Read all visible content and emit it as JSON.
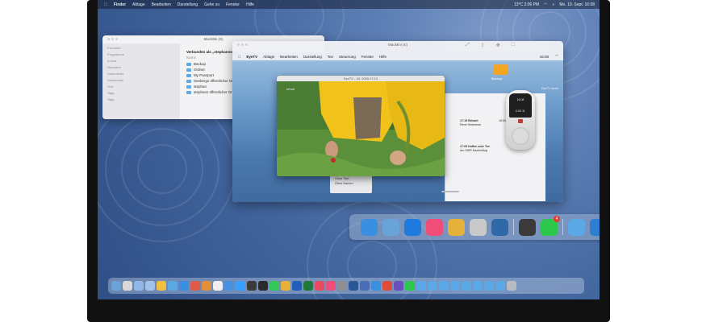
{
  "host_menubar": {
    "items": [
      "Finder",
      "Ablage",
      "Bearbeiten",
      "Darstellung",
      "Gehe zu",
      "Fenster",
      "Hilfe"
    ],
    "clock": "Mo. 10. Sept. 16:08",
    "status": "13°C 2:06 PM"
  },
  "finder": {
    "window_title": "MacMini (S)",
    "sidebar": [
      "Favoriten",
      "Programme",
      "iCloud",
      "Netzwerk",
      "Dokumente",
      "Downloads",
      "Orte",
      "Tags",
      "Tags"
    ],
    "connection": "Verbunden als „stephanmesse“",
    "column_header": "Name",
    "items": [
      "Backup",
      "Ordner",
      "My Passport",
      "Seebergs öffentlicher Ordner",
      "stephan",
      "stephans öffentlicher Ordner"
    ]
  },
  "vm": {
    "window_title": "MacMini (S)",
    "guest_menu": [
      "EyeTV",
      "Ablage",
      "Bearbeiten",
      "Darstellung",
      "Ton",
      "Steuerung",
      "Fenster",
      "Hilfe"
    ],
    "guest_status": [
      "16:08"
    ],
    "photo_title": "EyeTV - 18. 2005 07:10",
    "photo_label": "Inhalt",
    "desktop_folder": "Backup",
    "desktop_label": "EyeTV Archiv",
    "remote_screen": [
      "16:08",
      "0:00:11"
    ],
    "list_items": [
      "17:15 Brisant",
      "René Hinterman",
      "17:05 Kaffee oder Tee",
      "Am SWR Nachmittag",
      "18:00"
    ],
    "side_items": [
      "Ohne Titel",
      "Ohne Namen"
    ]
  },
  "vm_dock": [
    {
      "name": "finder-icon",
      "color": "#3a8fe0"
    },
    {
      "name": "preview-icon",
      "color": "#6aa3d8"
    },
    {
      "name": "safari-icon",
      "color": "#1f7ae0"
    },
    {
      "name": "itunes-icon",
      "color": "#ef4d7a"
    },
    {
      "name": "chrome-icon",
      "color": "#e4b23b"
    },
    {
      "name": "disk-utility-icon",
      "color": "#c9c9c9"
    },
    {
      "name": "eyetv-icon",
      "color": "#2e6aa8"
    },
    {
      "name": "quicktime-icon",
      "color": "#3a3a3a"
    },
    {
      "name": "facetime-icon",
      "color": "#2ec74d",
      "badge": "4"
    },
    {
      "name": "folder-icon",
      "color": "#5aa9e6"
    },
    {
      "name": "globe-icon",
      "color": "#2f7fd1"
    },
    {
      "name": "trash-icon",
      "color": "#b7bcc4"
    }
  ],
  "host_dock_colors": [
    "#6aa3d8",
    "#d8d8d8",
    "#8fb8e6",
    "#a3c2ea",
    "#f0c040",
    "#5aa9e6",
    "#3a8fe0",
    "#e05a4a",
    "#e48f3a",
    "#f0f0f0",
    "#4a90e2",
    "#3aa0ff",
    "#3a3a3a",
    "#2a2a2a",
    "#34c759",
    "#e4b23b",
    "#1f5fb8",
    "#1f7a3a",
    "#e84a5f",
    "#ef4d7a",
    "#8e8e93",
    "#2b5797",
    "#4b6cb7",
    "#3a8fe0",
    "#e04c3c",
    "#6b4fbb",
    "#2ec74d",
    "#5aa9e6",
    "#5aa9e6",
    "#5aa9e6",
    "#5aa9e6",
    "#5aa9e6",
    "#5aa9e6",
    "#5aa9e6",
    "#5aa9e6",
    "#b7bcc4"
  ]
}
